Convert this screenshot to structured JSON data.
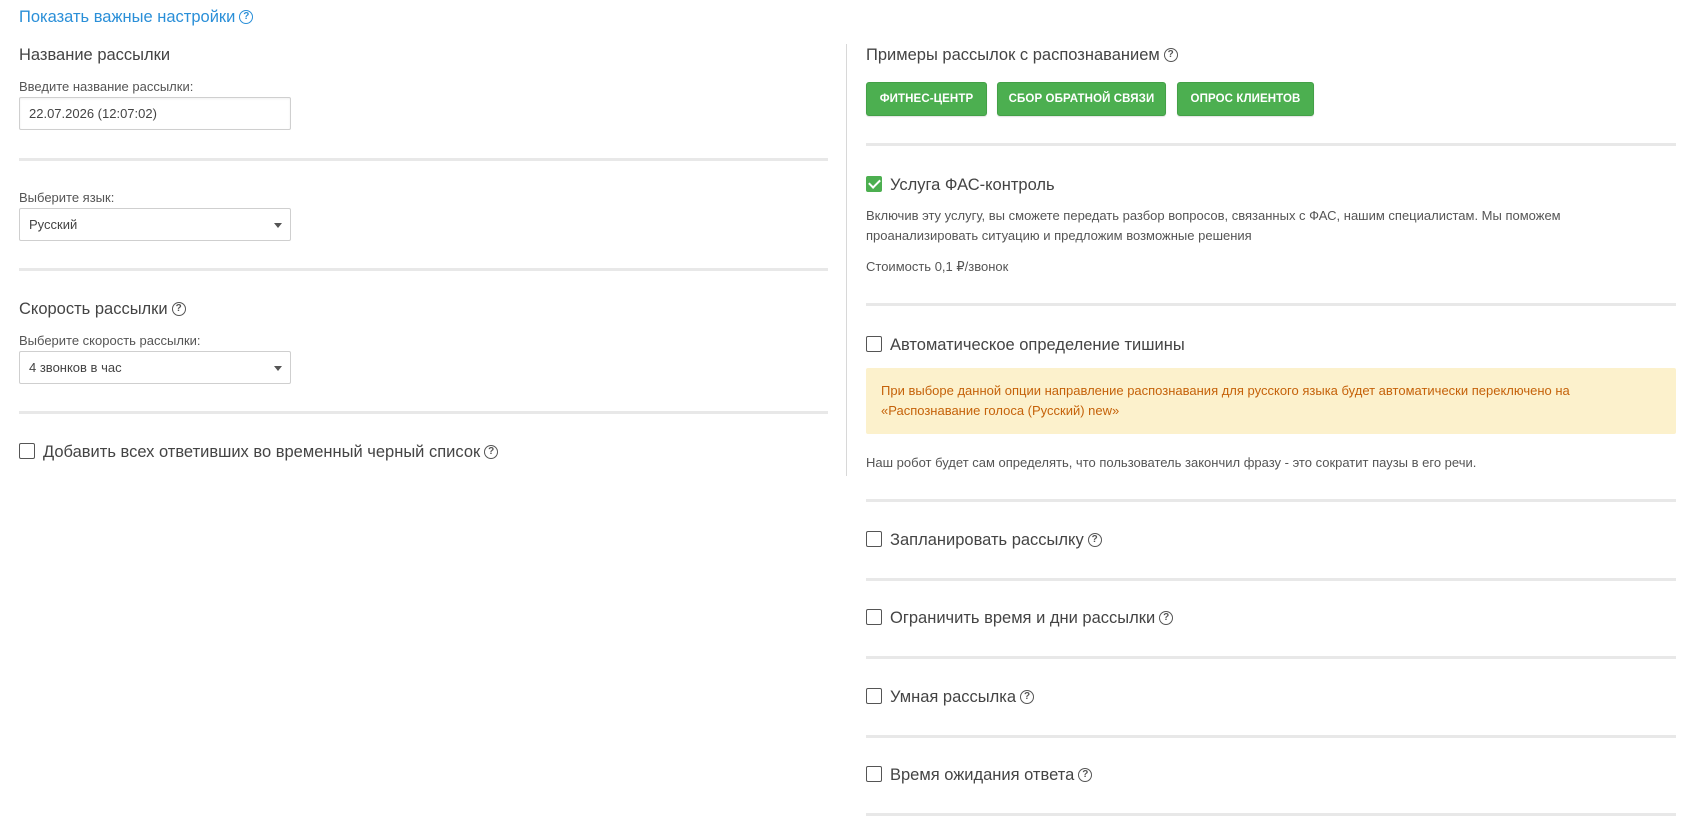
{
  "top_link": {
    "label": "Показать важные настройки"
  },
  "left": {
    "name_section": {
      "title": "Название рассылки",
      "label": "Введите название рассылки:",
      "value": "22.07.2026 (12:07:02)"
    },
    "language_section": {
      "label": "Выберите язык:",
      "selected": "Русский"
    },
    "speed_section": {
      "title": "Скорость рассылки",
      "label": "Выберите скорость рассылки:",
      "selected": "4 звонков в час"
    },
    "blacklist": {
      "label": "Добавить всех ответивших во временный черный список",
      "checked": false
    }
  },
  "right": {
    "examples": {
      "title": "Примеры рассылок с распознаванием",
      "buttons": [
        "ФИТНЕС-ЦЕНТР",
        "СБОР ОБРАТНОЙ СВЯЗИ",
        "ОПРОС КЛИЕНТОВ"
      ]
    },
    "fas": {
      "label": "Услуга ФАС-контроль",
      "checked": true,
      "description_line1": "Включив эту услугу, вы сможете передать разбор вопросов, связанных с ФАС, нашим специалистам. Мы поможем",
      "description_line2": "проанализировать ситуацию и предложим возможные решения",
      "cost": "Стоимость 0,1 ₽/звонок"
    },
    "silence": {
      "label": "Автоматическое определение тишины",
      "checked": false,
      "warning_line1": "При выборе данной опции направление распознавания для русского языка будет автоматически переключено на",
      "warning_line2": "«Распознавание голоса (Русский) new»",
      "description": "Наш робот будет сам определять, что пользователь закончил фразу - это сократит паузы в его речи."
    },
    "options": [
      {
        "label": "Запланировать рассылку",
        "checked": false
      },
      {
        "label": "Ограничить время и дни рассылки",
        "checked": false
      },
      {
        "label": "Умная рассылка",
        "checked": false
      },
      {
        "label": "Время ожидания ответа",
        "checked": false
      }
    ]
  },
  "colors": {
    "link": "#2a8fd8",
    "accent_green": "#4caf50",
    "warning_bg": "#fcf1cc",
    "warning_text": "#c5620a"
  }
}
